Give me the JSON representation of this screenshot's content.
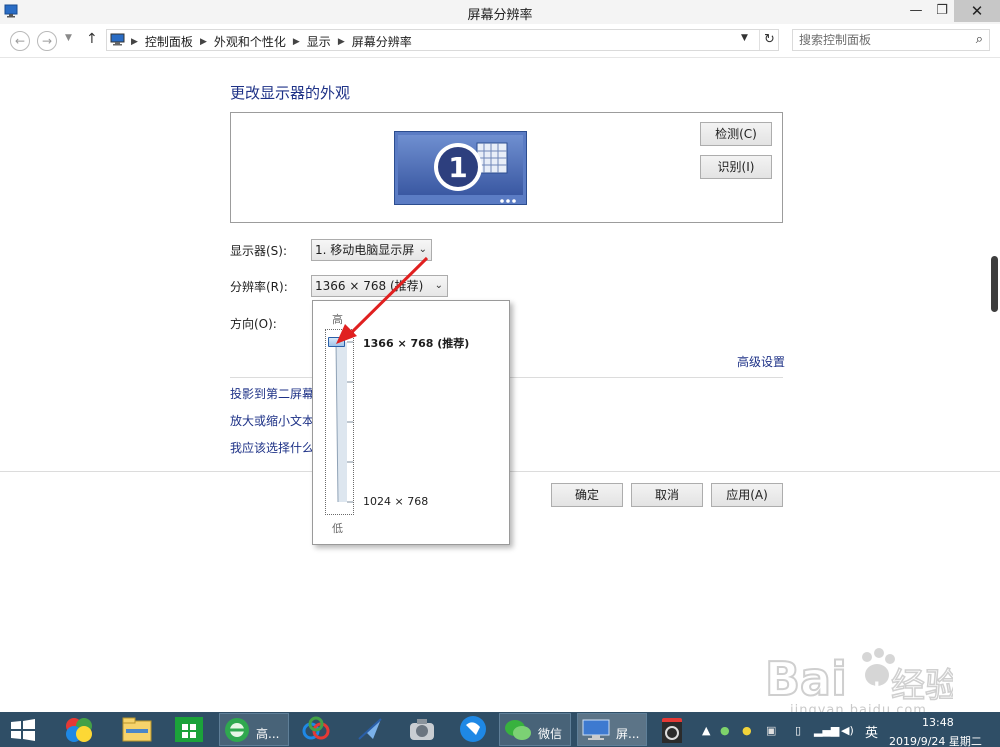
{
  "window": {
    "title": "屏幕分辨率"
  },
  "address": {
    "crumbs": [
      "控制面板",
      "外观和个性化",
      "显示",
      "屏幕分辨率"
    ],
    "search_placeholder": "搜索控制面板"
  },
  "main": {
    "heading": "更改显示器的外观",
    "monitor_number": "1",
    "detect_label": "检测(C)",
    "identify_label": "识别(I)",
    "display_label": "显示器(S):",
    "display_value": "1. 移动电脑显示屏",
    "resolution_label": "分辨率(R):",
    "resolution_value": "1366 × 768 (推荐)",
    "orientation_label": "方向(O):",
    "advanced_link": "高级设置",
    "links": [
      "投影到第二屏幕",
      "放大或缩小文本",
      "我应该选择什么"
    ],
    "ok_label": "确定",
    "cancel_label": "取消",
    "apply_label": "应用(A)"
  },
  "slider_popup": {
    "high_label": "高",
    "low_label": "低",
    "top_option": "1366 × 768 (推荐)",
    "bottom_option": "1024 × 768",
    "selected_position": 1.0
  },
  "taskbar": {
    "items": [
      {
        "icon": "windows-start-icon"
      },
      {
        "icon": "photo-app-icon"
      },
      {
        "icon": "file-explorer-icon"
      },
      {
        "icon": "store-icon"
      },
      {
        "icon": "browser-icon",
        "label": "高..."
      },
      {
        "icon": "baidu-cloud-icon"
      },
      {
        "icon": "feather-app-icon"
      },
      {
        "icon": "cleaner-icon"
      },
      {
        "icon": "chat-bubble-icon"
      },
      {
        "icon": "wechat-icon",
        "label": "微信"
      },
      {
        "icon": "screen-resolution-icon",
        "label": "屏..."
      },
      {
        "icon": "recorder-icon"
      }
    ],
    "ime": "英",
    "time": "13:48",
    "date": "2019/9/24 星期二"
  },
  "watermark": {
    "brand": "Bai 经验",
    "url": "jingyan.baidu.com"
  },
  "colors": {
    "link": "#1e3287",
    "taskbar": "#2f4e66",
    "arrow": "#e02020",
    "monitor_tile": "#4b6fb5"
  }
}
